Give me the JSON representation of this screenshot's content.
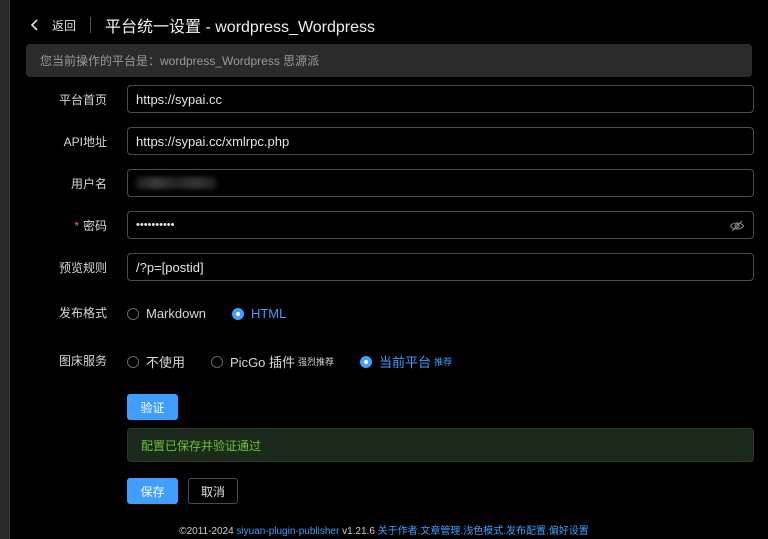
{
  "header": {
    "back_label": "返回",
    "title": "平台统一设置 - wordpress_Wordpress"
  },
  "notice": "您当前操作的平台是：wordpress_Wordpress 思源派",
  "form": {
    "homepage": {
      "label": "平台首页",
      "value": "https://sypai.cc"
    },
    "api": {
      "label": "API地址",
      "value": "https://sypai.cc/xmlrpc.php"
    },
    "username": {
      "label": "用户名"
    },
    "password": {
      "label": "密码",
      "required_mark": "*",
      "value": "••••••••••"
    },
    "preview": {
      "label": "预览规则",
      "value": "/?p=[postid]"
    },
    "format": {
      "label": "发布格式",
      "options": [
        {
          "label": "Markdown",
          "checked": false
        },
        {
          "label": "HTML",
          "checked": true
        }
      ]
    },
    "image": {
      "label": "图床服务",
      "options": [
        {
          "label": "不使用",
          "tag": "",
          "checked": false
        },
        {
          "label": "PicGo 插件",
          "tag": "强烈推荐",
          "checked": false
        },
        {
          "label": "当前平台",
          "tag": "推荐",
          "checked": true
        }
      ]
    }
  },
  "verify_button": "验证",
  "success_message": "配置已保存并验证通过",
  "save_button": "保存",
  "cancel_button": "取消",
  "footer": {
    "copyright": "©2011-2024 ",
    "plugin_link": "siyuan-plugin-publisher",
    "version": " v1.21.6 ",
    "links": "关于作者.文章管理.浅色模式.发布配置.偏好设置"
  },
  "colors": {
    "accent": "#409eff",
    "success": "#67c23a",
    "required": "#f56c6c"
  }
}
